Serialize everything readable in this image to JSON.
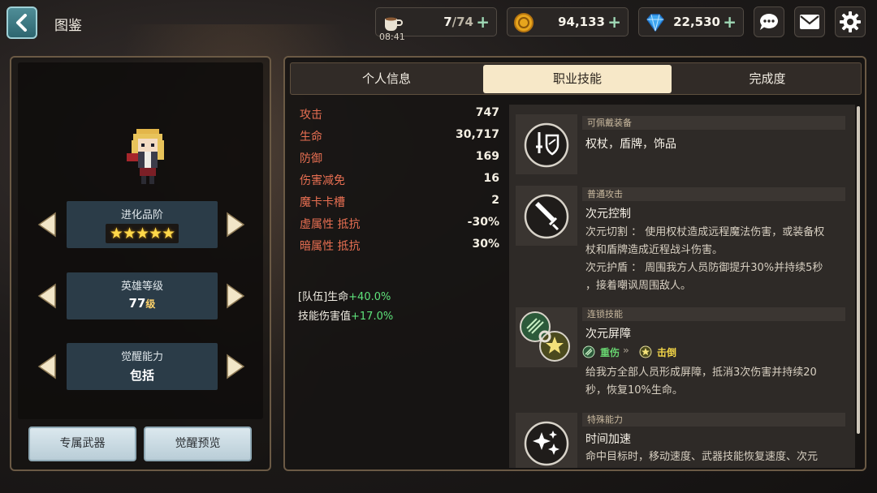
{
  "header": {
    "title": "图鉴",
    "stamina": {
      "current": "7",
      "max": "/74",
      "timer": "08:41"
    },
    "gold": "94,133",
    "gems": "22,530"
  },
  "hero": {
    "evolution_label": "进化品阶",
    "stars": "★★★★★",
    "level_label": "英雄等级",
    "level_value": "77",
    "level_unit": "级",
    "awaken_label": "觉醒能力",
    "awaken_value": "包括",
    "buttons": {
      "weapon": "专属武器",
      "awaken_preview": "觉醒预览"
    }
  },
  "tabs": [
    "个人信息",
    "职业技能",
    "完成度"
  ],
  "active_tab": "职业技能",
  "stats": [
    {
      "label": "攻击",
      "value": "747"
    },
    {
      "label": "生命",
      "value": "30,717"
    },
    {
      "label": "防御",
      "value": "169"
    },
    {
      "label": "伤害减免",
      "value": "16"
    },
    {
      "label": "魔卡卡槽",
      "value": "2"
    },
    {
      "label": "虚属性 抵抗",
      "value": "-30%"
    },
    {
      "label": "暗属性 抵抗",
      "value": "30%"
    }
  ],
  "bonuses": [
    {
      "label": "[队伍]生命",
      "value": "+40.0%"
    },
    {
      "label": "技能伤害值",
      "value": "+17.0%"
    }
  ],
  "skills": {
    "equip": {
      "header": "可佩戴装备",
      "text": "权杖，盾牌，饰品"
    },
    "normal": {
      "header": "普通攻击",
      "name": "次元控制",
      "line1": "次元切割 ： 使用权杖造成远程魔法伤害，或装备权",
      "line2": "杖和盾牌造成近程战斗伤害。",
      "line3": "次元护盾 ： 周围我方人员防御提升30%并持续5秒",
      "line4": "，接着嘲讽周围敌人。"
    },
    "chain": {
      "header": "连锁技能",
      "name": "次元屏障",
      "from_tag": "重伤",
      "to_tag": "击倒",
      "line1": "给我方全部人员形成屏障，抵消3次伤害并持续20",
      "line2": "秒，恢复10%生命。"
    },
    "special": {
      "header": "特殊能力",
      "name": "时间加速",
      "line1": "命中目标时，移动速度、武器技能恢复速度、次元"
    }
  },
  "colors": {
    "stat_label": "#e86f52",
    "bonus_green": "#5ee27a",
    "tab_active_bg": "#f7e8c8",
    "chain_from": "#67d26f",
    "chain_to": "#f2d447"
  }
}
